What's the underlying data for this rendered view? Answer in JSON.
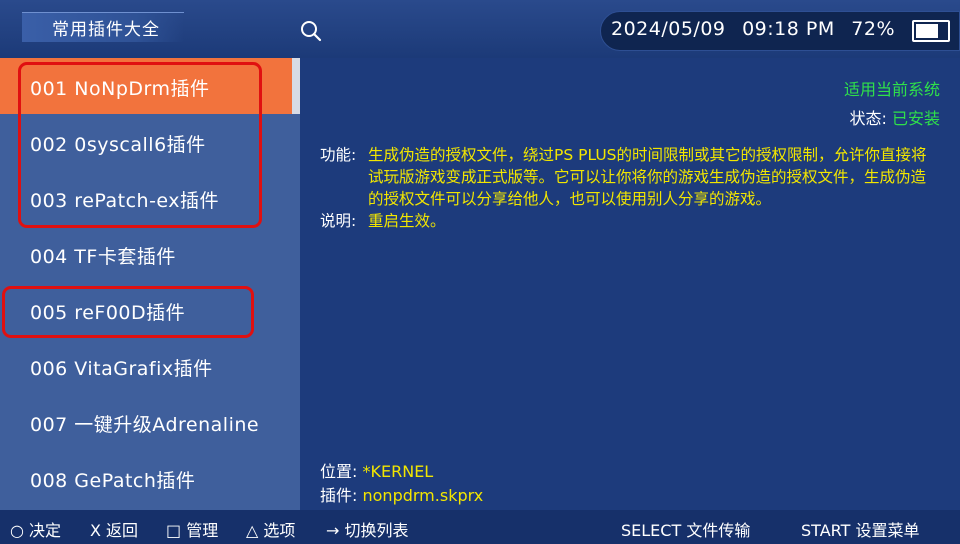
{
  "header": {
    "title": "常用插件大全",
    "date": "2024/05/09",
    "time": "09:18 PM",
    "battery": "72%",
    "battery_level": 0.72
  },
  "plugins": [
    {
      "label": "001  NoNpDrm插件",
      "selected": true
    },
    {
      "label": "002  0syscall6插件",
      "selected": false
    },
    {
      "label": "003  rePatch-ex插件",
      "selected": false
    },
    {
      "label": "004  TF卡套插件",
      "selected": false
    },
    {
      "label": "005  reF00D插件",
      "selected": false
    },
    {
      "label": "006  VitaGrafix插件",
      "selected": false
    },
    {
      "label": "007  一键升级Adrenaline",
      "selected": false
    },
    {
      "label": "008  GePatch插件",
      "selected": false
    }
  ],
  "detail": {
    "applies": "适用当前系统",
    "status_key": "状态:",
    "status_value": "已安装",
    "function_key": "功能:",
    "function_value": "生成伪造的授权文件，绕过PS PLUS的时间限制或其它的授权限制，允许你直接将试玩版游戏变成正式版等。它可以让你将你的游戏生成伪造的授权文件，生成伪造的授权文件可以分享给他人，也可以使用别人分享的游戏。",
    "note_key": "说明:",
    "note_value": "重启生效。",
    "location_key": "位置:",
    "location_value": "*KERNEL",
    "plugin_key": "插件:",
    "plugin_value": "nonpdrm.skprx"
  },
  "footer": {
    "confirm": "○ 决定",
    "back": "X 返回",
    "manage": "□ 管理",
    "options": "△ 选项",
    "switch": "→ 切换列表",
    "select": "SELECT 文件传输",
    "start": "START 设置菜单"
  },
  "colors": {
    "selected": "#f2733d",
    "highlight_box": "#e01010",
    "yellow_text": "#f2e600",
    "green_text": "#2fe04a"
  }
}
